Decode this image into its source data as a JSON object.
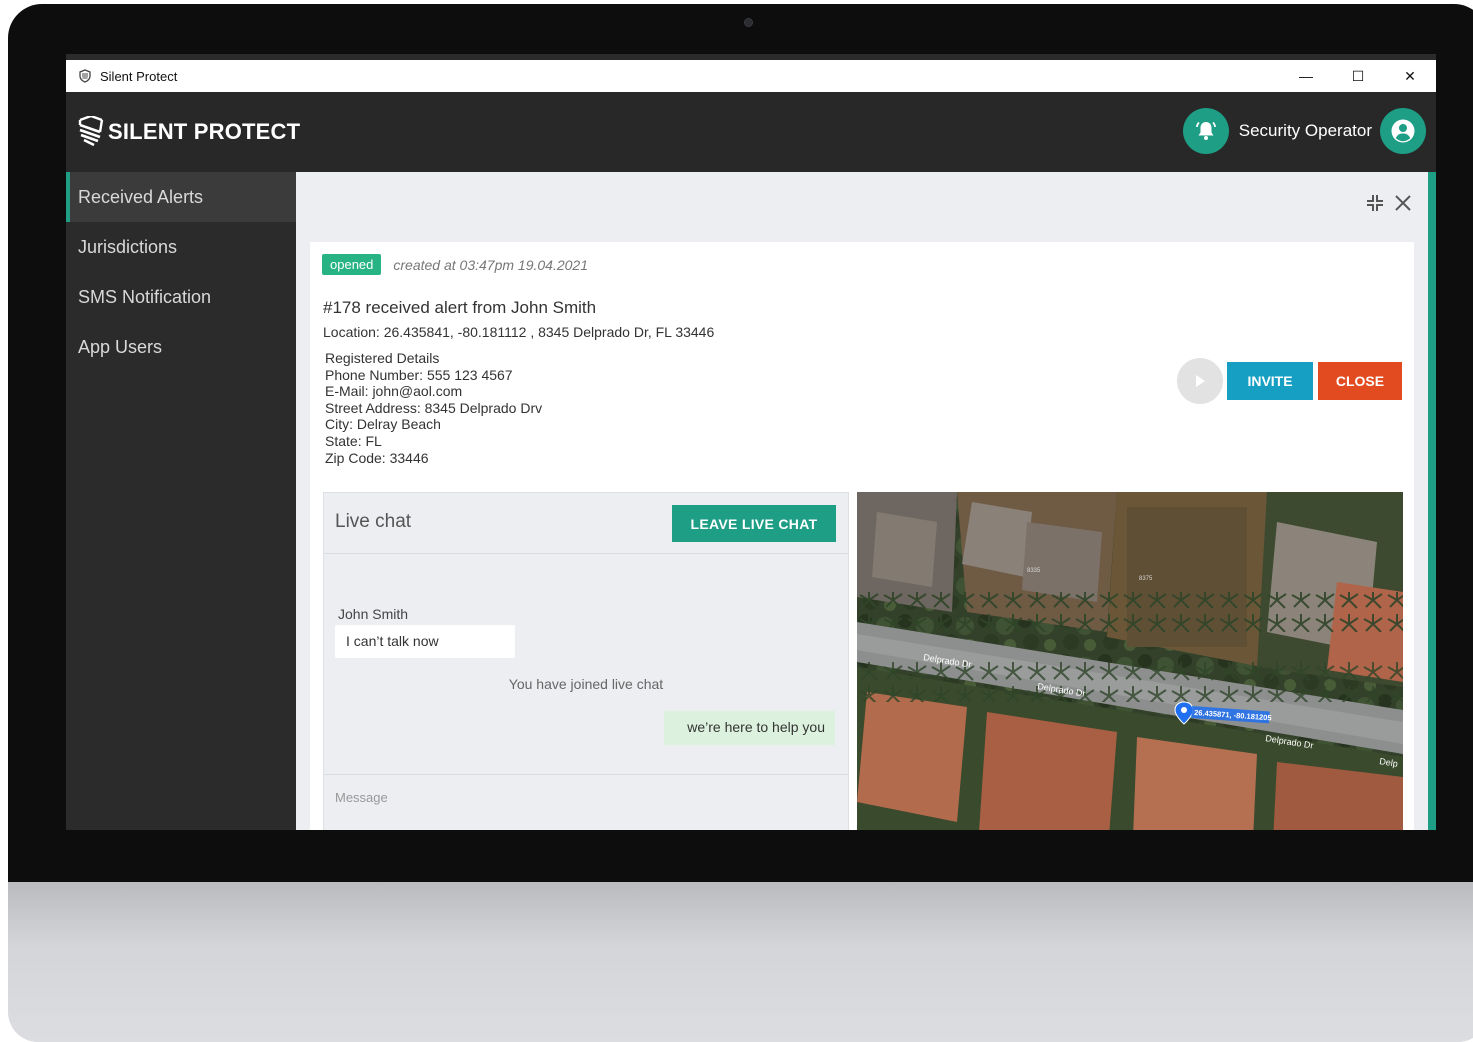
{
  "window": {
    "title": "Silent Protect",
    "controls": {
      "minimize": "—",
      "maximize": "☐",
      "close": "✕"
    }
  },
  "brand": {
    "logo_text": "SILENT PROTECT",
    "accent": "#1d9e85"
  },
  "header": {
    "notification_icon": "bell-icon",
    "user_name": "Security Operator",
    "avatar_icon": "user-circle-icon"
  },
  "sidebar": {
    "items": [
      {
        "label": "Received Alerts",
        "active": true
      },
      {
        "label": "Jurisdictions",
        "active": false
      },
      {
        "label": "SMS Notification",
        "active": false
      },
      {
        "label": "App Users",
        "active": false
      }
    ]
  },
  "alert": {
    "status": "opened",
    "created": "created at 03:47pm 19.04.2021",
    "title": "#178 received alert from John Smith",
    "location": "Location: 26.435841, -80.181112 , 8345 Delprado Dr, FL 33446",
    "details": {
      "heading": "Registered Details",
      "phone": "Phone Number: 555 123 4567",
      "email": "E-Mail: john@aol.com",
      "street": "Street Address: 8345 Delprado Drv",
      "city": "City: Delray Beach",
      "state": "State: FL",
      "zip": "Zip Code: 33446"
    },
    "actions": {
      "invite": "INVITE",
      "close": "CLOSE"
    }
  },
  "chat": {
    "title": "Live chat",
    "leave_label": "LEAVE LIVE CHAT",
    "sender": "John Smith",
    "incoming": "I can’t talk now",
    "system": "You have joined live chat",
    "outgoing": "we’re here to help you",
    "input_placeholder": "Message"
  },
  "map": {
    "street_labels": [
      "Delprado Dr",
      "Delprado Dr",
      "Delprado Dr",
      "Delp"
    ],
    "pin_label": "26.435871, -80.181205",
    "lot_labels": [
      "8335",
      "8375"
    ]
  }
}
